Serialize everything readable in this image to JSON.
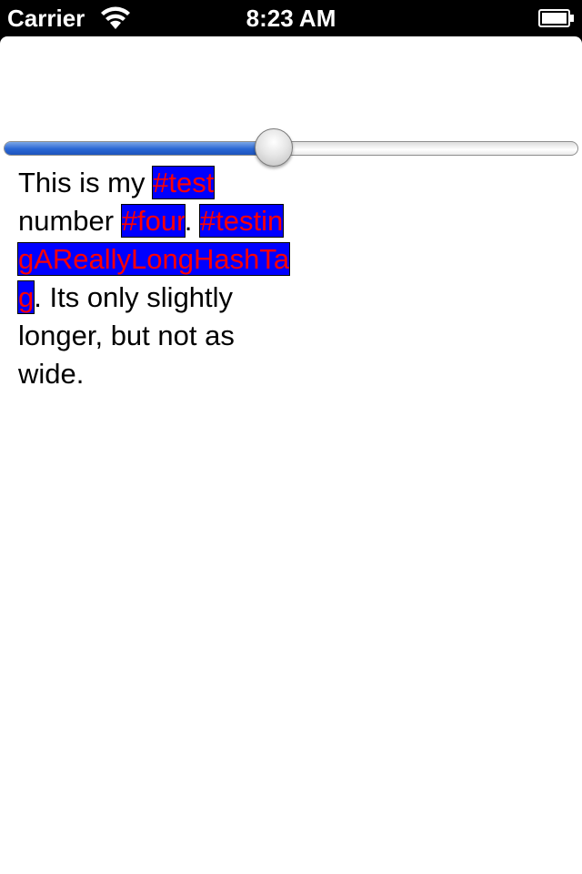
{
  "status_bar": {
    "carrier": "Carrier",
    "time": "8:23 AM",
    "wifi_icon": "wifi-icon",
    "battery_icon": "battery-icon"
  },
  "slider": {
    "value_fraction": 0.47,
    "fill_color": "#2a66d4"
  },
  "text": {
    "segments": [
      {
        "type": "text",
        "value": "This is my "
      },
      {
        "type": "hashtag",
        "value": "#test"
      },
      {
        "type": "text",
        "value": " number "
      },
      {
        "type": "hashtag",
        "value": "#four"
      },
      {
        "type": "text",
        "value": ". "
      },
      {
        "type": "hashtag",
        "value": "#testingAReallyLongHashTag"
      },
      {
        "type": "text",
        "value": ". Its only slightly longer, but not as wide."
      }
    ],
    "hashtag_background": "#0000ff",
    "hashtag_color": "#ff0000"
  }
}
